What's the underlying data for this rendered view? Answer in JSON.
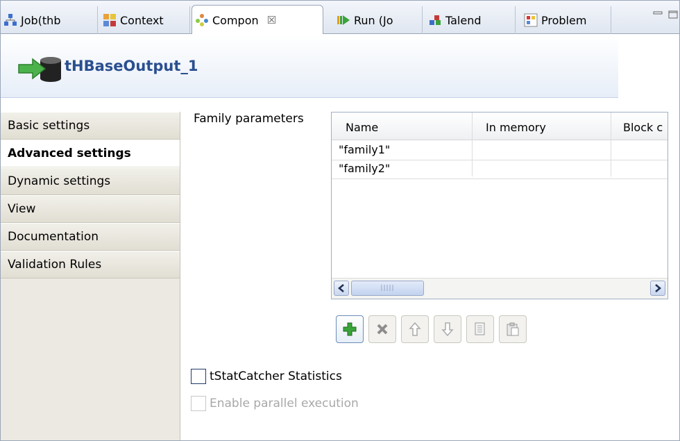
{
  "tabs": [
    {
      "label": "Job(thb",
      "icon": "job-icon"
    },
    {
      "label": "Context",
      "icon": "context-icon"
    },
    {
      "label": "Compon",
      "icon": "component-icon",
      "active": true,
      "close": "☒"
    },
    {
      "label": "Run (Jo",
      "icon": "run-icon"
    },
    {
      "label": "Talend",
      "icon": "talend-icon"
    },
    {
      "label": "Problem",
      "icon": "problem-icon"
    }
  ],
  "header": {
    "title": "tHBaseOutput_1",
    "logo": "hbase-output-icon"
  },
  "nav": {
    "items": [
      {
        "label": "Basic settings"
      },
      {
        "label": "Advanced settings",
        "active": true
      },
      {
        "label": "Dynamic settings"
      },
      {
        "label": "View"
      },
      {
        "label": "Documentation"
      },
      {
        "label": "Validation Rules"
      }
    ]
  },
  "content": {
    "family_label": "Family parameters",
    "table": {
      "columns": [
        "Name",
        "In memory",
        "Block c"
      ],
      "rows": [
        [
          "\"family1\"",
          "",
          ""
        ],
        [
          "\"family2\"",
          "",
          ""
        ]
      ]
    },
    "toolbar": [
      "add",
      "remove",
      "move-up",
      "move-down",
      "copy",
      "paste"
    ],
    "stat_catcher": {
      "label": "tStatCatcher Statistics",
      "checked": false
    },
    "parallel": {
      "label": "Enable parallel execution",
      "checked": false,
      "disabled": true
    }
  },
  "colors": {
    "header_title": "#2a4f8f",
    "add_plus": "#3aa33a"
  }
}
